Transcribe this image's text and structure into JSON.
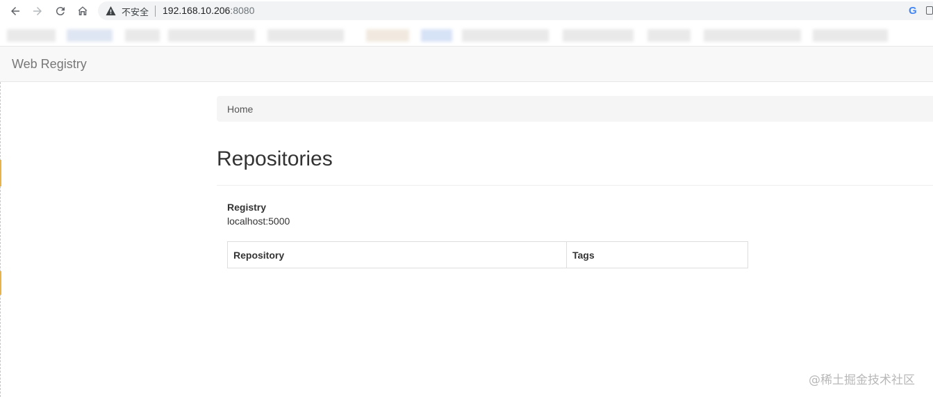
{
  "browser": {
    "insecure_label": "不安全",
    "url_host": "192.168.10.206",
    "url_port": ":8080",
    "google_icon": "G"
  },
  "icons": {
    "back": "arrow-left-icon",
    "forward": "arrow-right-icon",
    "reload": "reload-icon",
    "home": "home-icon",
    "warning": "warning-icon",
    "extension": "extension-icon"
  },
  "navbar": {
    "brand": "Web Registry"
  },
  "breadcrumb": {
    "home": "Home"
  },
  "page": {
    "title": "Repositories"
  },
  "registry": {
    "label": "Registry",
    "value": "localhost:5000"
  },
  "table": {
    "headers": [
      "Repository",
      "Tags"
    ],
    "rows": []
  },
  "watermark": "@稀土掘金技术社区",
  "colors": {
    "navbar_bg": "#f8f8f8",
    "breadcrumb_bg": "#f5f5f5",
    "text": "#333333",
    "brand": "#777777"
  }
}
